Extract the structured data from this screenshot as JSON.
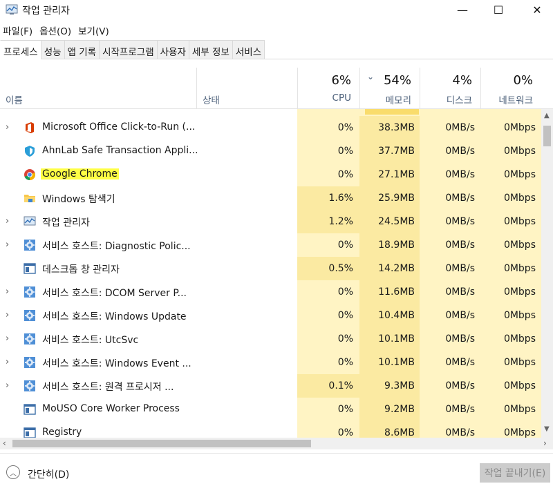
{
  "window": {
    "title": "작업 관리자",
    "minimize_glyph": "—",
    "maximize_glyph": "☐",
    "close_glyph": "✕"
  },
  "menu": [
    "파일(F)",
    "옵션(O)",
    "보기(V)"
  ],
  "tabs": [
    "프로세스",
    "성능",
    "앱 기록",
    "시작프로그램",
    "사용자",
    "세부 정보",
    "서비스"
  ],
  "columns": {
    "name": "이름",
    "status": "상태",
    "cpu": {
      "pct": "6%",
      "label": "CPU"
    },
    "memory": {
      "pct": "54%",
      "label": "메모리"
    },
    "disk": {
      "pct": "4%",
      "label": "디스크"
    },
    "network": {
      "pct": "0%",
      "label": "네트워크"
    }
  },
  "processes": [
    {
      "name": "Microsoft Office Click-to-Run (...",
      "expandable": true,
      "icon": "office-icon",
      "cpu": "0%",
      "mem": "38.3MB",
      "disk": "0MB/s",
      "net": "0Mbps"
    },
    {
      "name": "AhnLab Safe Transaction Appli...",
      "expandable": false,
      "icon": "shield-icon",
      "cpu": "0%",
      "mem": "37.7MB",
      "disk": "0MB/s",
      "net": "0Mbps"
    },
    {
      "name": "Google Chrome",
      "expandable": false,
      "icon": "chrome-icon",
      "highlighted": true,
      "cpu": "0%",
      "mem": "27.1MB",
      "disk": "0MB/s",
      "net": "0Mbps"
    },
    {
      "name": "Windows 탐색기",
      "expandable": false,
      "icon": "folder-icon",
      "cpu": "1.6%",
      "mem": "25.9MB",
      "disk": "0MB/s",
      "net": "0Mbps"
    },
    {
      "name": "작업 관리자",
      "expandable": true,
      "icon": "task-manager-icon",
      "cpu": "1.2%",
      "mem": "24.5MB",
      "disk": "0MB/s",
      "net": "0Mbps"
    },
    {
      "name": "서비스 호스트: Diagnostic Polic...",
      "expandable": true,
      "icon": "gear-icon",
      "cpu": "0%",
      "mem": "18.9MB",
      "disk": "0MB/s",
      "net": "0Mbps"
    },
    {
      "name": "데스크톱 창 관리자",
      "expandable": false,
      "icon": "window-icon",
      "cpu": "0.5%",
      "mem": "14.2MB",
      "disk": "0MB/s",
      "net": "0Mbps"
    },
    {
      "name": "서비스 호스트: DCOM Server P...",
      "expandable": true,
      "icon": "gear-icon",
      "cpu": "0%",
      "mem": "11.6MB",
      "disk": "0MB/s",
      "net": "0Mbps"
    },
    {
      "name": "서비스 호스트: Windows Update",
      "expandable": true,
      "icon": "gear-icon",
      "cpu": "0%",
      "mem": "10.4MB",
      "disk": "0MB/s",
      "net": "0Mbps"
    },
    {
      "name": "서비스 호스트: UtcSvc",
      "expandable": true,
      "icon": "gear-icon",
      "cpu": "0%",
      "mem": "10.1MB",
      "disk": "0MB/s",
      "net": "0Mbps"
    },
    {
      "name": "서비스 호스트: Windows Event ...",
      "expandable": true,
      "icon": "gear-icon",
      "cpu": "0%",
      "mem": "10.1MB",
      "disk": "0MB/s",
      "net": "0Mbps"
    },
    {
      "name": "서비스 호스트: 원격 프로시저 ...",
      "expandable": true,
      "icon": "gear-icon",
      "cpu": "0.1%",
      "mem": "9.3MB",
      "disk": "0MB/s",
      "net": "0Mbps"
    },
    {
      "name": "MoUSO Core Worker Process",
      "expandable": false,
      "icon": "window-icon",
      "cpu": "0%",
      "mem": "9.2MB",
      "disk": "0MB/s",
      "net": "0Mbps"
    },
    {
      "name": "Registry",
      "expandable": false,
      "icon": "window-icon",
      "cpu": "0%",
      "mem": "8.6MB",
      "disk": "0MB/s",
      "net": "0Mbps"
    }
  ],
  "footer": {
    "collapse_label": "간단히(D)",
    "end_task_label": "작업 끝내기(E)"
  },
  "colors": {
    "heat_light": "#fff4c4",
    "heat_medium": "#fbeaa2",
    "highlight": "#ffff44"
  }
}
